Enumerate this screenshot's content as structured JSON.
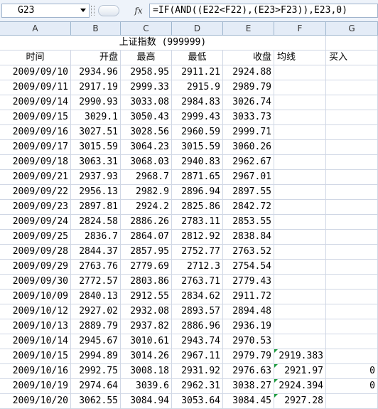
{
  "name_box": "G23",
  "formula": "=IF(AND((E22<F22),(E23>F23)),E23,0)",
  "fx_label": "fx",
  "columns": [
    "A",
    "B",
    "C",
    "D",
    "E",
    "F",
    "G"
  ],
  "sheet_title": "上证指数 (999999)",
  "headers": [
    "时间",
    "开盘",
    "最高",
    "最低",
    "收盘",
    "均线",
    "买入"
  ],
  "rows": [
    {
      "date": "2009/09/10",
      "open": "2934.96",
      "high": "2958.95",
      "low": "2911.21",
      "close": "2924.88",
      "ma": "",
      "buy": ""
    },
    {
      "date": "2009/09/11",
      "open": "2917.19",
      "high": "2999.33",
      "low": "2915.9",
      "close": "2989.79",
      "ma": "",
      "buy": ""
    },
    {
      "date": "2009/09/14",
      "open": "2990.93",
      "high": "3033.08",
      "low": "2984.83",
      "close": "3026.74",
      "ma": "",
      "buy": ""
    },
    {
      "date": "2009/09/15",
      "open": "3029.1",
      "high": "3050.43",
      "low": "2999.43",
      "close": "3033.73",
      "ma": "",
      "buy": ""
    },
    {
      "date": "2009/09/16",
      "open": "3027.51",
      "high": "3028.56",
      "low": "2960.59",
      "close": "2999.71",
      "ma": "",
      "buy": ""
    },
    {
      "date": "2009/09/17",
      "open": "3015.59",
      "high": "3064.23",
      "low": "3015.59",
      "close": "3060.26",
      "ma": "",
      "buy": ""
    },
    {
      "date": "2009/09/18",
      "open": "3063.31",
      "high": "3068.03",
      "low": "2940.83",
      "close": "2962.67",
      "ma": "",
      "buy": ""
    },
    {
      "date": "2009/09/21",
      "open": "2937.93",
      "high": "2968.7",
      "low": "2871.65",
      "close": "2967.01",
      "ma": "",
      "buy": ""
    },
    {
      "date": "2009/09/22",
      "open": "2956.13",
      "high": "2982.9",
      "low": "2896.94",
      "close": "2897.55",
      "ma": "",
      "buy": ""
    },
    {
      "date": "2009/09/23",
      "open": "2897.81",
      "high": "2924.2",
      "low": "2825.86",
      "close": "2842.72",
      "ma": "",
      "buy": ""
    },
    {
      "date": "2009/09/24",
      "open": "2824.58",
      "high": "2886.26",
      "low": "2783.11",
      "close": "2853.55",
      "ma": "",
      "buy": ""
    },
    {
      "date": "2009/09/25",
      "open": "2836.7",
      "high": "2864.07",
      "low": "2812.92",
      "close": "2838.84",
      "ma": "",
      "buy": ""
    },
    {
      "date": "2009/09/28",
      "open": "2844.37",
      "high": "2857.95",
      "low": "2752.77",
      "close": "2763.52",
      "ma": "",
      "buy": ""
    },
    {
      "date": "2009/09/29",
      "open": "2763.76",
      "high": "2779.69",
      "low": "2712.3",
      "close": "2754.54",
      "ma": "",
      "buy": ""
    },
    {
      "date": "2009/09/30",
      "open": "2772.57",
      "high": "2803.86",
      "low": "2763.71",
      "close": "2779.43",
      "ma": "",
      "buy": ""
    },
    {
      "date": "2009/10/09",
      "open": "2840.13",
      "high": "2912.55",
      "low": "2834.62",
      "close": "2911.72",
      "ma": "",
      "buy": ""
    },
    {
      "date": "2009/10/12",
      "open": "2927.02",
      "high": "2932.08",
      "low": "2893.57",
      "close": "2894.48",
      "ma": "",
      "buy": ""
    },
    {
      "date": "2009/10/13",
      "open": "2889.79",
      "high": "2937.82",
      "low": "2886.96",
      "close": "2936.19",
      "ma": "",
      "buy": ""
    },
    {
      "date": "2009/10/14",
      "open": "2945.67",
      "high": "3010.61",
      "low": "2943.74",
      "close": "2970.53",
      "ma": "",
      "buy": ""
    },
    {
      "date": "2009/10/15",
      "open": "2994.89",
      "high": "3014.26",
      "low": "2967.11",
      "close": "2979.79",
      "ma": "2919.383",
      "buy": ""
    },
    {
      "date": "2009/10/16",
      "open": "2992.75",
      "high": "3008.18",
      "low": "2931.92",
      "close": "2976.63",
      "ma": "2921.97",
      "buy": "0"
    },
    {
      "date": "2009/10/19",
      "open": "2974.64",
      "high": "3039.6",
      "low": "2962.31",
      "close": "3038.27",
      "ma": "2924.394",
      "buy": "0"
    },
    {
      "date": "2009/10/20",
      "open": "3062.55",
      "high": "3084.94",
      "low": "3053.64",
      "close": "3084.45",
      "ma": "2927.28",
      "buy": ""
    }
  ]
}
